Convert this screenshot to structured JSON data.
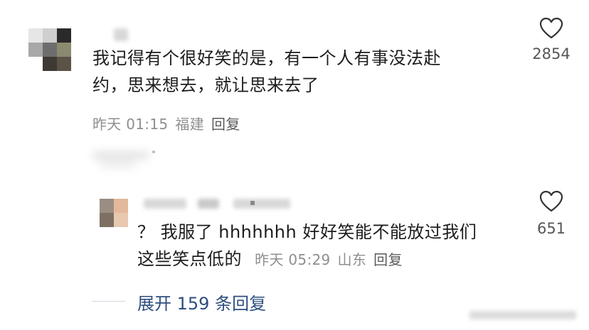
{
  "comment": {
    "text_line1": "我记得有个很好笑的是，有一个人有事没法赴",
    "text_line2": "约，思来想去，就让思来去了",
    "time": "昨天 01:15",
    "location": "福建",
    "reply_label": "回复",
    "likes": "2854"
  },
  "reply": {
    "text_line1": "？ 我服了 hhhhhhh 好好笑能不能放过我们",
    "text_line2_prefix": "这些笑点低的",
    "time": "昨天 05:29",
    "location": "山东",
    "reply_label": "回复",
    "likes": "651"
  },
  "expand": {
    "label": "展开 159 条回复"
  },
  "colors": {
    "link_blue": "#2e4e7e",
    "meta_gray": "#8f8f8f"
  }
}
